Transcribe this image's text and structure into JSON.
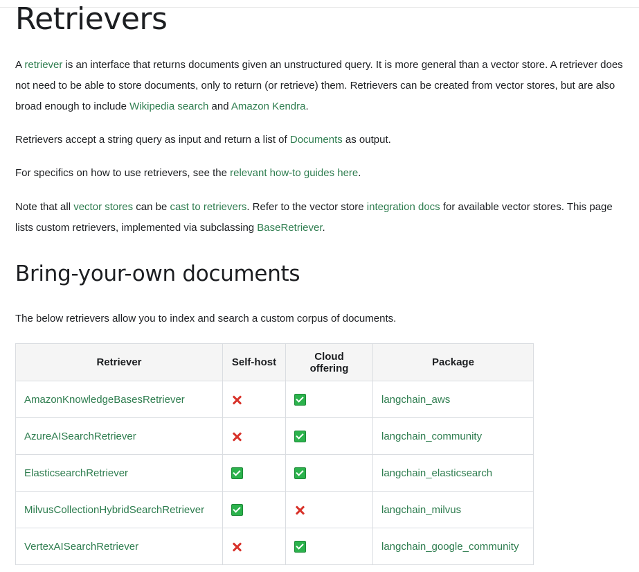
{
  "page": {
    "title": "Retrievers",
    "intro": {
      "t1": "A ",
      "l1": "retriever",
      "t2": " is an interface that returns documents given an unstructured query. It is more general than a vector store. A retriever does not need to be able to store documents, only to return (or retrieve) them. Retrievers can be created from vector stores, but are also broad enough to include ",
      "l2": "Wikipedia search",
      "t3": " and ",
      "l3": "Amazon Kendra",
      "t4": "."
    },
    "p2": {
      "t1": "Retrievers accept a string query as input and return a list of ",
      "l1": "Documents",
      "t2": " as output."
    },
    "p3": {
      "t1": "For specifics on how to use retrievers, see the ",
      "l1": "relevant how-to guides here",
      "t2": "."
    },
    "p4": {
      "t1": "Note that all ",
      "l1": "vector stores",
      "t2": " can be ",
      "l2": "cast to retrievers",
      "t3": ". Refer to the vector store ",
      "l3": "integration docs",
      "t4": " for available vector stores. This page lists custom retrievers, implemented via subclassing ",
      "l4": "BaseRetriever",
      "t5": "."
    },
    "section_heading": "Bring-your-own documents",
    "section_intro": "The below retrievers allow you to index and search a custom corpus of documents."
  },
  "table": {
    "headers": {
      "retriever": "Retriever",
      "self_host": "Self-host",
      "cloud": "Cloud offering",
      "package": "Package"
    },
    "rows": [
      {
        "retriever": "AmazonKnowledgeBasesRetriever",
        "self_host": "cross-icon",
        "cloud": "check-icon",
        "package": "langchain_aws"
      },
      {
        "retriever": "AzureAISearchRetriever",
        "self_host": "cross-icon",
        "cloud": "check-icon",
        "package": "langchain_community"
      },
      {
        "retriever": "ElasticsearchRetriever",
        "self_host": "check-icon",
        "cloud": "check-icon",
        "package": "langchain_elasticsearch"
      },
      {
        "retriever": "MilvusCollectionHybridSearchRetriever",
        "self_host": "check-icon",
        "cloud": "cross-icon",
        "package": "langchain_milvus"
      },
      {
        "retriever": "VertexAISearchRetriever",
        "self_host": "cross-icon",
        "cloud": "check-icon",
        "package": "langchain_google_community"
      }
    ]
  },
  "colors": {
    "link": "#2e7d4f",
    "text": "#1c1e21",
    "check": "#2bb24c",
    "cross": "#d8322a",
    "header_bg": "#f5f5f5",
    "border": "#dadde1"
  }
}
